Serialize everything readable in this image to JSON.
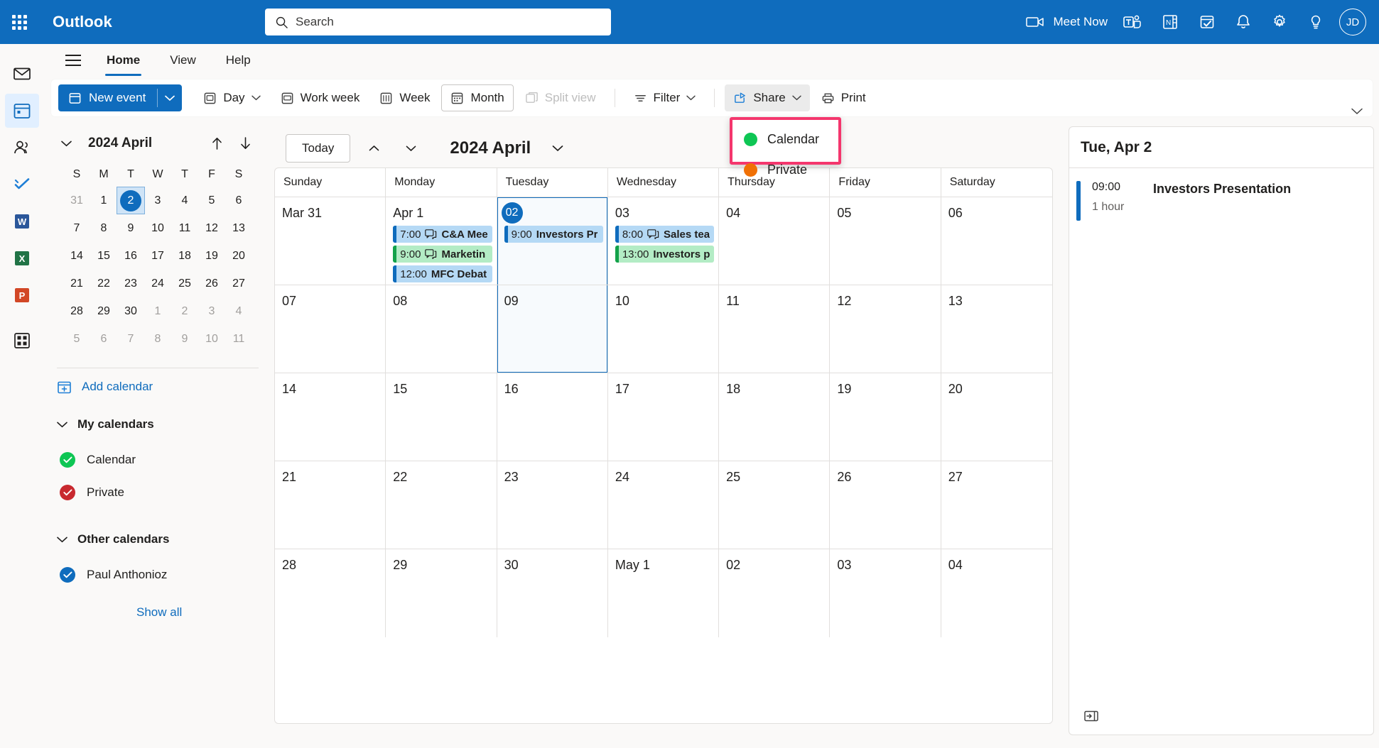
{
  "app": {
    "brand": "Outlook",
    "avatar_initials": "JD"
  },
  "search": {
    "placeholder": "Search",
    "value": ""
  },
  "topbar": {
    "meet_now": "Meet Now",
    "icons": [
      "app-launcher-icon",
      "camera-icon",
      "teams-icon",
      "onenote-icon",
      "todo-icon",
      "notifications-icon",
      "settings-icon",
      "help-icon"
    ]
  },
  "ribbon_tabs": [
    {
      "label": "Home",
      "active": true
    },
    {
      "label": "View",
      "active": false
    },
    {
      "label": "Help",
      "active": false
    }
  ],
  "toolbar": {
    "new_event": "New event",
    "day": "Day",
    "work_week": "Work week",
    "week": "Week",
    "month": "Month",
    "split_view": "Split view",
    "filter": "Filter",
    "share": "Share",
    "print": "Print"
  },
  "share_menu": {
    "items": [
      {
        "label": "Calendar",
        "color": "#0ec654"
      },
      {
        "label": "Private",
        "color": "#f07005"
      }
    ],
    "highlight_color": "#f4366d"
  },
  "mini_calendar": {
    "title": "2024 April",
    "dow": [
      "S",
      "M",
      "T",
      "W",
      "T",
      "F",
      "S"
    ],
    "weeks": [
      [
        {
          "d": "31",
          "muted": true
        },
        {
          "d": "1"
        },
        {
          "d": "2",
          "today": true
        },
        {
          "d": "3"
        },
        {
          "d": "4"
        },
        {
          "d": "5"
        },
        {
          "d": "6"
        }
      ],
      [
        {
          "d": "7"
        },
        {
          "d": "8"
        },
        {
          "d": "9"
        },
        {
          "d": "10"
        },
        {
          "d": "11"
        },
        {
          "d": "12"
        },
        {
          "d": "13"
        }
      ],
      [
        {
          "d": "14"
        },
        {
          "d": "15"
        },
        {
          "d": "16"
        },
        {
          "d": "17"
        },
        {
          "d": "18"
        },
        {
          "d": "19"
        },
        {
          "d": "20"
        }
      ],
      [
        {
          "d": "21"
        },
        {
          "d": "22"
        },
        {
          "d": "23"
        },
        {
          "d": "24"
        },
        {
          "d": "25"
        },
        {
          "d": "26"
        },
        {
          "d": "27"
        }
      ],
      [
        {
          "d": "28"
        },
        {
          "d": "29"
        },
        {
          "d": "30"
        },
        {
          "d": "1",
          "muted": true
        },
        {
          "d": "2",
          "muted": true
        },
        {
          "d": "3",
          "muted": true
        },
        {
          "d": "4",
          "muted": true
        }
      ],
      [
        {
          "d": "5",
          "muted": true
        },
        {
          "d": "6",
          "muted": true
        },
        {
          "d": "7",
          "muted": true
        },
        {
          "d": "8",
          "muted": true
        },
        {
          "d": "9",
          "muted": true
        },
        {
          "d": "10",
          "muted": true
        },
        {
          "d": "11",
          "muted": true
        }
      ]
    ]
  },
  "sidebar": {
    "add_calendar": "Add calendar",
    "my_calendars_label": "My calendars",
    "my_calendars": [
      {
        "label": "Calendar",
        "color": "#0ec654",
        "checked": true
      },
      {
        "label": "Private",
        "color": "#c8292f",
        "checked": true
      }
    ],
    "other_calendars_label": "Other calendars",
    "other_calendars": [
      {
        "label": "Paul Anthonioz",
        "color": "#0f6cbd",
        "checked": true
      }
    ],
    "show_all": "Show all"
  },
  "calendar": {
    "today_button": "Today",
    "title": "2024 April",
    "day_headers": [
      "Sunday",
      "Monday",
      "Tuesday",
      "Wednesday",
      "Thursday",
      "Friday",
      "Saturday"
    ],
    "weeks": [
      {
        "days": [
          {
            "num": "Mar 31",
            "events": []
          },
          {
            "num": "Apr 1",
            "events": [
              {
                "time": "7:00",
                "title": "C&A Mee",
                "color": "blue",
                "teams": true
              },
              {
                "time": "9:00",
                "title": "Marketin",
                "color": "green",
                "teams": true
              },
              {
                "time": "12:00",
                "title": "MFC Debat",
                "color": "blue",
                "teams": false
              }
            ]
          },
          {
            "num": "02",
            "today": true,
            "selected": true,
            "events": [
              {
                "time": "9:00",
                "title": "Investors Pr",
                "color": "blue",
                "teams": false
              }
            ]
          },
          {
            "num": "03",
            "events": [
              {
                "time": "8:00",
                "title": "Sales tea",
                "color": "blue",
                "teams": true
              },
              {
                "time": "13:00",
                "title": "Investors p",
                "color": "green",
                "teams": false
              }
            ]
          },
          {
            "num": "04",
            "events": []
          },
          {
            "num": "05",
            "events": []
          },
          {
            "num": "06",
            "events": []
          }
        ]
      },
      {
        "days": [
          {
            "num": "07",
            "events": []
          },
          {
            "num": "08",
            "events": []
          },
          {
            "num": "09",
            "selected": true,
            "events": []
          },
          {
            "num": "10",
            "events": []
          },
          {
            "num": "11",
            "events": []
          },
          {
            "num": "12",
            "events": []
          },
          {
            "num": "13",
            "events": []
          }
        ]
      },
      {
        "days": [
          {
            "num": "14",
            "events": []
          },
          {
            "num": "15",
            "events": []
          },
          {
            "num": "16",
            "events": []
          },
          {
            "num": "17",
            "events": []
          },
          {
            "num": "18",
            "events": []
          },
          {
            "num": "19",
            "events": []
          },
          {
            "num": "20",
            "events": []
          }
        ]
      },
      {
        "days": [
          {
            "num": "21",
            "events": []
          },
          {
            "num": "22",
            "events": []
          },
          {
            "num": "23",
            "events": []
          },
          {
            "num": "24",
            "events": []
          },
          {
            "num": "25",
            "events": []
          },
          {
            "num": "26",
            "events": []
          },
          {
            "num": "27",
            "events": []
          }
        ]
      },
      {
        "days": [
          {
            "num": "28",
            "events": []
          },
          {
            "num": "29",
            "events": []
          },
          {
            "num": "30",
            "events": []
          },
          {
            "num": "May 1",
            "events": []
          },
          {
            "num": "02",
            "events": []
          },
          {
            "num": "03",
            "events": []
          },
          {
            "num": "04",
            "events": []
          }
        ]
      }
    ]
  },
  "agenda": {
    "date_header": "Tue, Apr 2",
    "events": [
      {
        "time": "09:00",
        "duration": "1 hour",
        "title": "Investors Presentation",
        "color": "#0f6cbd"
      }
    ]
  }
}
